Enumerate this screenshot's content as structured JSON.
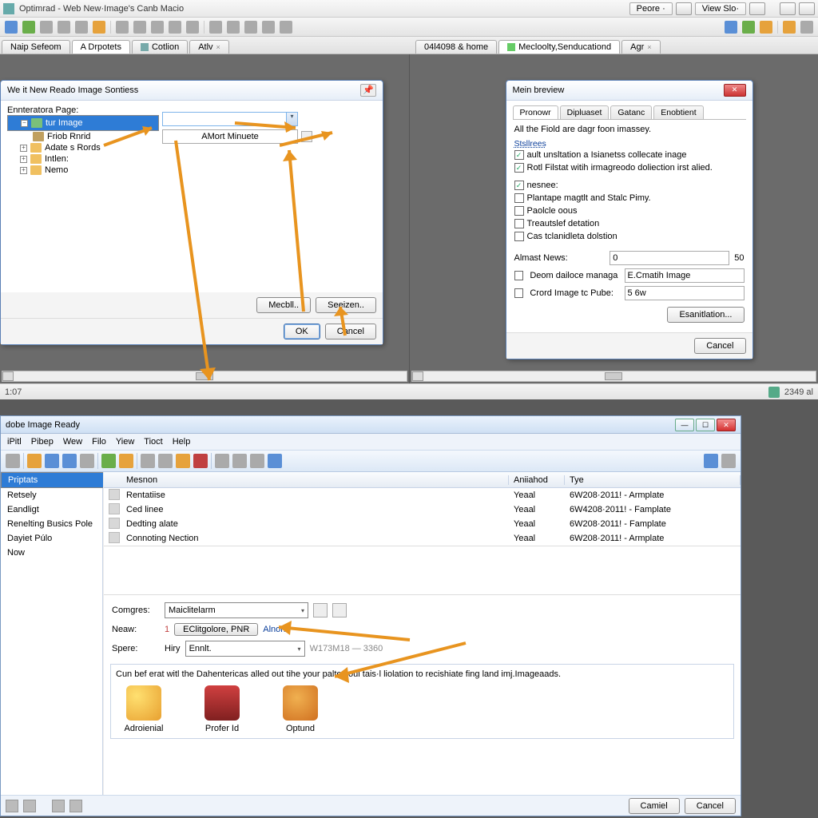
{
  "top_app": {
    "title": "Optimrad - Web New·Image's Canb Macio",
    "header_buttons": {
      "peore": "Peore ·",
      "view_slo": "View Slo·"
    },
    "tabs_left": [
      {
        "label": "Naip Sefeom"
      },
      {
        "label": "A Drpotets"
      },
      {
        "label": "Cotlion"
      },
      {
        "label": "Atlv"
      }
    ],
    "tabs_right": [
      {
        "label": "04l4098 & home"
      },
      {
        "label": "Mecloolty,Senducationd"
      },
      {
        "label": "Agr"
      }
    ],
    "left_dialog": {
      "title": "We it New Reado Image Sontiess",
      "folder_label": "Ennteratora Page:",
      "tree": [
        {
          "label": "tur Image",
          "selected": true
        },
        {
          "label": "Friob Rnrid"
        },
        {
          "label": "Adate s Rords"
        },
        {
          "label": "Intlen:"
        },
        {
          "label": "Nemo"
        }
      ],
      "combo_value": "",
      "text_value": "AMort Minuete",
      "btn_mecbl": "Mecbll..",
      "btn_seeizn": "Seeizen..",
      "btn_ok": "OK",
      "btn_cancel": "Cancel"
    },
    "right_dialog": {
      "title": "Mein breview",
      "tabs": [
        "Pronowr",
        "Dipluaset",
        "Gatanc",
        "Enobtient"
      ],
      "intro": "All the Fiold are dagr foon imassey.",
      "section_label": "Stsllrees",
      "checks_top": [
        {
          "label": "ault unsltation a Isianetss collecate inage",
          "checked": true
        },
        {
          "label": "Rotl Filstat witih irmagreodo doliection irst alied.",
          "checked": true
        }
      ],
      "neshee_label": "nesnee:",
      "neshee_checked": true,
      "checks2": [
        {
          "label": "Plantape magtlt and Stalc Pimy.",
          "checked": false
        },
        {
          "label": "Paolcle oous",
          "checked": false
        },
        {
          "label": "Treautslef detation",
          "checked": false
        },
        {
          "label": "Cas tclanidleta dolstion",
          "checked": false
        }
      ],
      "almast_label": "Almast News:",
      "almast_value": "0",
      "almast_suffix": "50",
      "deom_label": "Deom dailoce managa",
      "deom_value": "E.Cmatih Image",
      "crord_label": "Crord Image tc Pube:",
      "crord_value": "5 6w",
      "btn_esanil": "Esanitlation...",
      "btn_cancel": "Cancel"
    },
    "status_left": "1:07",
    "status_right": "2349 al"
  },
  "bottom_app": {
    "title": "dobe Image Ready",
    "menus": [
      "iPitl",
      "Pibep",
      "Wew",
      "Filo",
      "Yiew",
      "Tioct",
      "Help"
    ],
    "sidebar": [
      {
        "label": "Priptats",
        "selected": true
      },
      {
        "label": "Retsely"
      },
      {
        "label": "Eandligt"
      },
      {
        "label": "Renelting Busics Pole"
      },
      {
        "label": "Dayiet Púlo"
      },
      {
        "label": "Now"
      }
    ],
    "table": {
      "headers": {
        "name": "Mesnon",
        "a": "Aniiahod",
        "tye": "Tye"
      },
      "rows": [
        {
          "name": "Rentatiise",
          "a": "Yeaal",
          "tye": "6W208·2011! - Armplate"
        },
        {
          "name": "Ced linee",
          "a": "Yeaal",
          "tye": "6W4208·2011! - Famplate"
        },
        {
          "name": "Dedting alate",
          "a": "Yeaal",
          "tye": "6W208·2011! - Famplate"
        },
        {
          "name": "Connoting Nection",
          "a": "Yeaal",
          "tye": "6W208·2011! - Armplate"
        }
      ]
    },
    "form": {
      "comgres_label": "Comgres:",
      "comgres_value": "Maiclitelarm",
      "neaw_label": "Neaw:",
      "neaw_value": "EClitgolore, PNR",
      "alnone": "Alnone",
      "spere_label": "Spere:",
      "spere_key": "Hiry",
      "spere_value": "Ennlt.",
      "spere_hint": "W173M18 — 3360"
    },
    "desc": "Cun bef erat witl the Dahentericas alled out tihe your palte floui tais·l liolation to recishiate fing land imj.Imageaads.",
    "icons": [
      {
        "label": "Adroienial"
      },
      {
        "label": "Profer Id"
      },
      {
        "label": "Optund"
      }
    ],
    "btn_camiel": "Camiel",
    "btn_cancel": "Cancel"
  }
}
